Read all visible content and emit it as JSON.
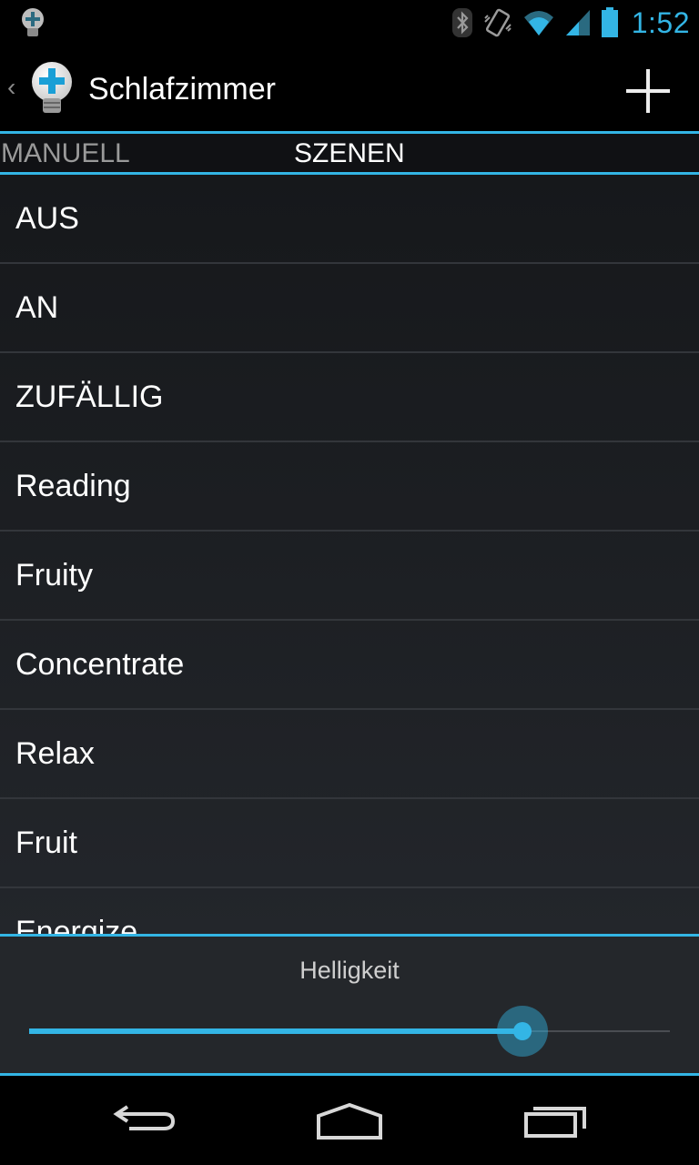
{
  "status_bar": {
    "time": "1:52",
    "icons": [
      "lightbulb-notification-icon",
      "bluetooth-icon",
      "vibrate-icon",
      "wifi-icon",
      "signal-icon",
      "battery-icon"
    ]
  },
  "action_bar": {
    "title": "Schlafzimmer",
    "icons": [
      "up-chevron-icon",
      "lightbulb-plus-icon",
      "plus-icon"
    ]
  },
  "tabs": [
    {
      "label": "MANUELL",
      "selected": false
    },
    {
      "label": "SZENEN",
      "selected": true
    }
  ],
  "scenes": [
    {
      "label": "AUS"
    },
    {
      "label": "AN"
    },
    {
      "label": "ZUFÄLLIG"
    },
    {
      "label": "Reading"
    },
    {
      "label": "Fruity"
    },
    {
      "label": "Concentrate"
    },
    {
      "label": "Relax"
    },
    {
      "label": "Fruit"
    },
    {
      "label": "Energize"
    }
  ],
  "brightness": {
    "label": "Helligkeit",
    "value_fraction": 0.77
  },
  "colors": {
    "accent": "#33b5e5",
    "list_bg": "#1b1d21",
    "divider": "#33363b"
  },
  "nav_bar": {
    "icons": [
      "back-icon",
      "home-icon",
      "recents-icon"
    ]
  }
}
